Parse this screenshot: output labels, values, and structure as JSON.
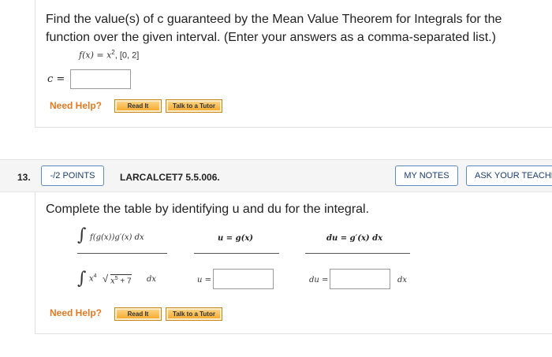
{
  "q12": {
    "question": "Find the value(s) of c guaranteed by the Mean Value Theorem for Integrals for the function over the given interval. (Enter your answers as a comma-separated list.)",
    "line1": "Find the value(s) of c guaranteed by the Mean Value Theorem for Integrals for the",
    "line2": "function over the given interval. (Enter your answers as a comma-separated list.)",
    "function_lhs": "f(x) = x",
    "function_exp": "2",
    "interval": ",   [0, 2]",
    "c_label": "c =",
    "c_value": "",
    "need_help": "Need Help?",
    "read_it": "Read It",
    "talk_to_tutor": "Talk to a Tutor"
  },
  "q13": {
    "number": "13.",
    "points": "-/2 POINTS",
    "source": "LARCALCET7 5.5.006.",
    "my_notes": "MY NOTES",
    "ask_teacher": "ASK YOUR TEACHER",
    "prompt": "Complete the table by identifying u and du for the integral.",
    "header_integral": "f(g(x))g′(x) dx",
    "header_u": "u = g(x)",
    "header_du": "du = g′(x) dx",
    "row_integrand": "x",
    "row_exp4": "4",
    "row_radicand": "x",
    "row_exp5": "5",
    "row_plus": " + 7",
    "row_dx": "dx",
    "u_label": "u =",
    "u_value": "",
    "du_label": "du =",
    "du_value": "",
    "du_suffix": "dx",
    "need_help": "Need Help?",
    "read_it": "Read It",
    "talk_to_tutor": "Talk to a Tutor"
  }
}
